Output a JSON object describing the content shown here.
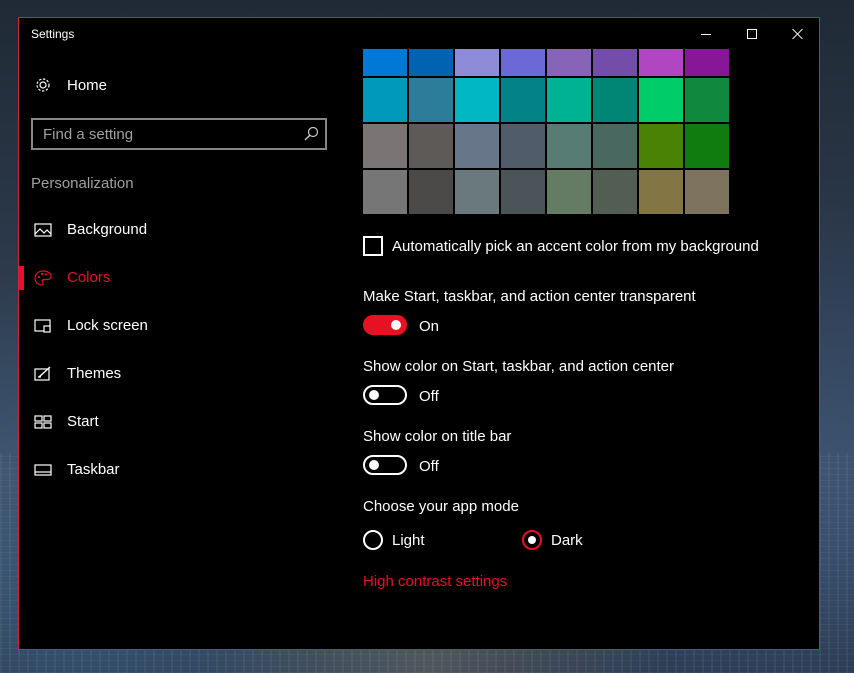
{
  "window": {
    "title": "Settings",
    "controls": {
      "minimize": "minimize",
      "maximize": "maximize",
      "close": "close"
    }
  },
  "sidebar": {
    "home_label": "Home",
    "search_placeholder": "Find a setting",
    "section_header": "Personalization",
    "items": [
      {
        "label": "Background",
        "icon": "picture-icon",
        "active": false
      },
      {
        "label": "Colors",
        "icon": "palette-icon",
        "active": true
      },
      {
        "label": "Lock screen",
        "icon": "lock-screen-icon",
        "active": false
      },
      {
        "label": "Themes",
        "icon": "themes-icon",
        "active": false
      },
      {
        "label": "Start",
        "icon": "start-icon",
        "active": false
      },
      {
        "label": "Taskbar",
        "icon": "taskbar-icon",
        "active": false
      }
    ]
  },
  "accent_colors": {
    "partial_row": [
      "#0078d7",
      "#0063b1",
      "#8e8cd8",
      "#6b69d6",
      "#8764b8",
      "#744da9",
      "#b146c2",
      "#881798"
    ],
    "rows": [
      [
        "#0099bc",
        "#2d7d9a",
        "#00b7c3",
        "#038387",
        "#00b294",
        "#018574",
        "#00cc6a",
        "#10893e"
      ],
      [
        "#7a7574",
        "#5d5a58",
        "#68768a",
        "#515c6b",
        "#567c73",
        "#486860",
        "#498205",
        "#107c10"
      ],
      [
        "#767676",
        "#4c4a48",
        "#69797e",
        "#4a5459",
        "#647c64",
        "#525e54",
        "#847545",
        "#7e735f"
      ]
    ]
  },
  "auto_pick": {
    "label": "Automatically pick an accent color from my background",
    "checked": false
  },
  "transparency": {
    "label": "Make Start, taskbar, and action center transparent",
    "state_text": "On",
    "on": true
  },
  "show_color_start": {
    "label": "Show color on Start, taskbar, and action center",
    "state_text": "Off",
    "on": false
  },
  "show_color_titlebar": {
    "label": "Show color on title bar",
    "state_text": "Off",
    "on": false
  },
  "app_mode": {
    "label": "Choose your app mode",
    "options": [
      {
        "label": "Light",
        "selected": false
      },
      {
        "label": "Dark",
        "selected": true
      }
    ]
  },
  "high_contrast_link": "High contrast settings",
  "colors": {
    "accent": "#e81123",
    "background": "#000000",
    "border": "#c4283a"
  }
}
